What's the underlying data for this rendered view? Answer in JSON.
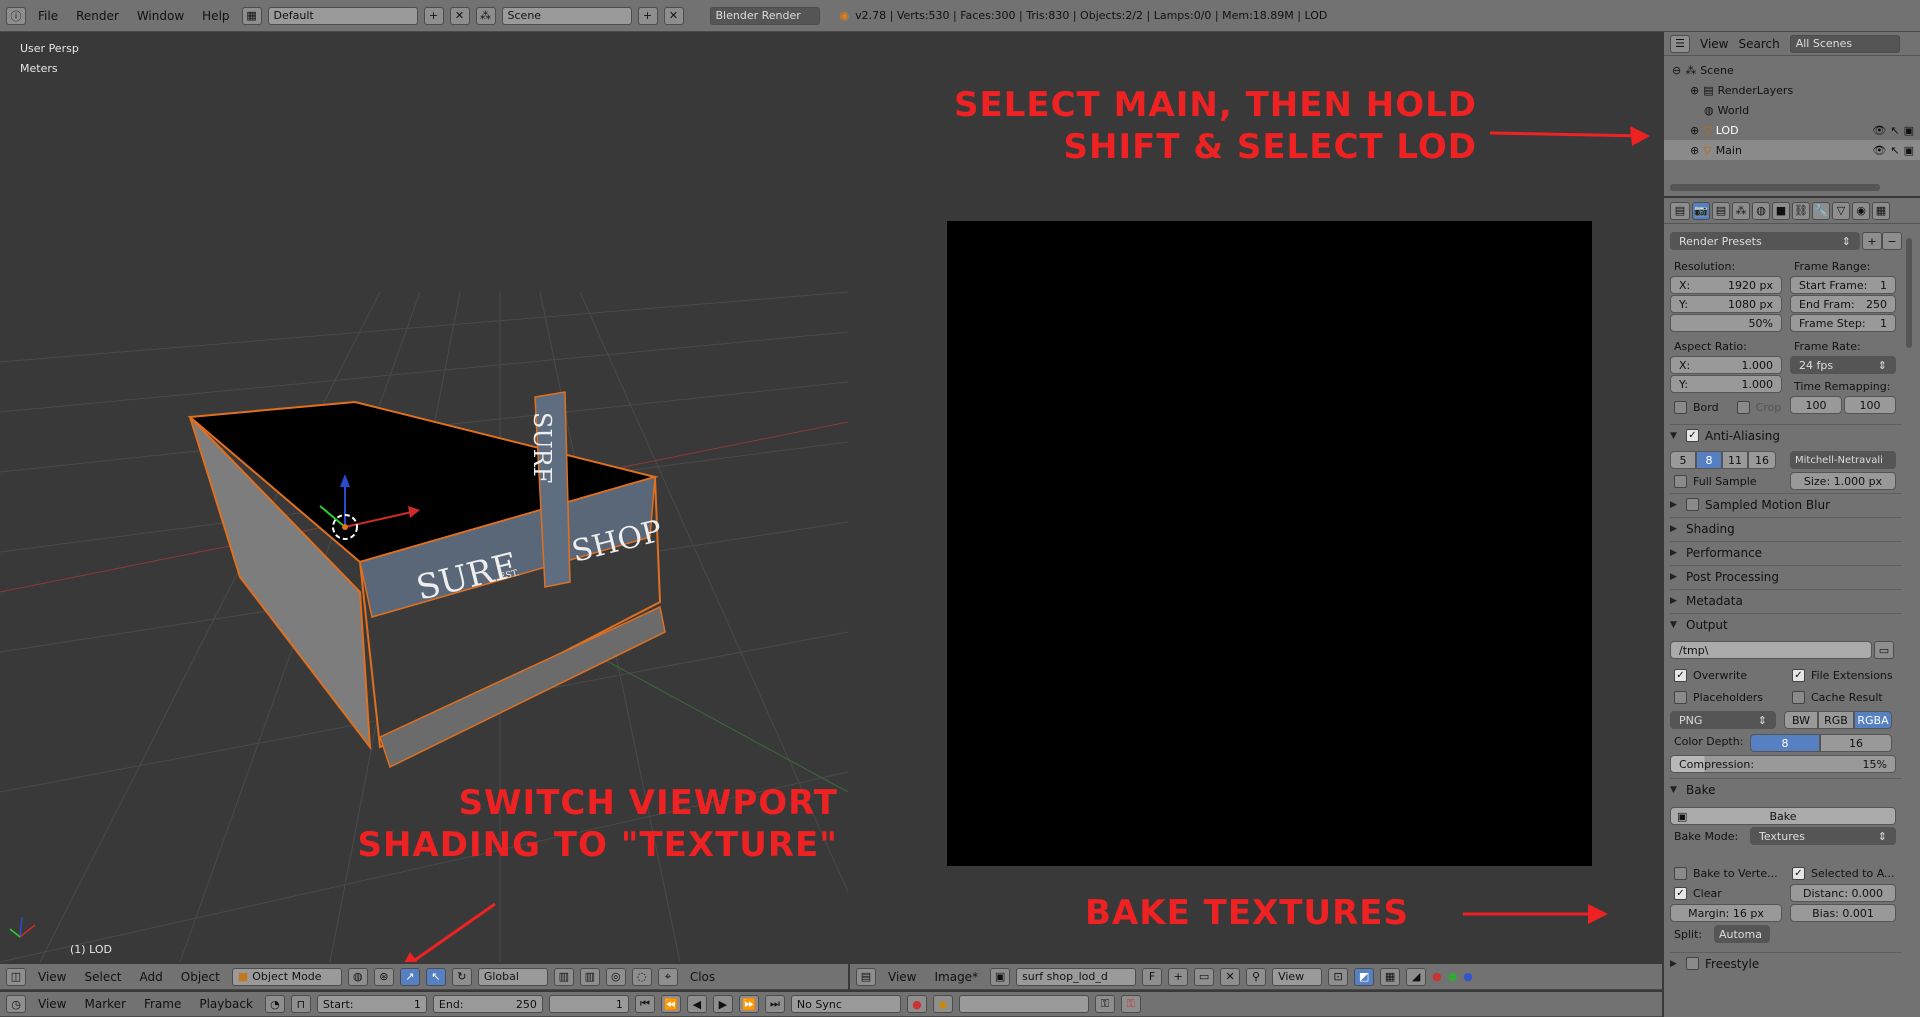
{
  "topbar": {
    "menus": [
      "File",
      "Render",
      "Window",
      "Help"
    ],
    "layout": "Default",
    "scene": "Scene",
    "engine": "Blender Render",
    "stats": "v2.78 | Verts:530 | Faces:300 | Tris:830 | Objects:2/2 | Lamps:0/0 | Mem:18.89M | LOD"
  },
  "viewport": {
    "view_name": "User Persp",
    "units": "Meters",
    "object_label": "(1) LOD",
    "sign_left": "SURF",
    "sign_est": "EST.",
    "sign_right": "SHOP",
    "sign_vertical": "SURF",
    "footer": {
      "menus": [
        "View",
        "Select",
        "Add",
        "Object"
      ],
      "mode": "Object Mode",
      "orientation": "Global",
      "tail": "Clos"
    }
  },
  "annotations": {
    "top": [
      "SELECT MAIN, THEN HOLD",
      "SHIFT & SELECT LOD"
    ],
    "shading": [
      "SWITCH VIEWPORT",
      "SHADING TO \"TEXTURE\""
    ],
    "bake": "BAKE TEXTURES"
  },
  "image_editor": {
    "footer": {
      "menus": [
        "View",
        "Image*"
      ],
      "image_name": "surf shop_lod_d",
      "fake_user": "F",
      "view_label": "View"
    }
  },
  "timeline": {
    "menus": [
      "View",
      "Marker",
      "Frame",
      "Playback"
    ],
    "start_label": "Start:",
    "start": "1",
    "end_label": "End:",
    "end": "250",
    "current": "1",
    "sync": "No Sync"
  },
  "outliner": {
    "view": "View",
    "search": "Search",
    "scenes": "All Scenes",
    "items": [
      {
        "label": "Scene"
      },
      {
        "label": "RenderLayers"
      },
      {
        "label": "World"
      },
      {
        "label": "LOD"
      },
      {
        "label": "Main"
      }
    ]
  },
  "properties": {
    "render_presets": "Render Presets",
    "resolution_label": "Resolution:",
    "res_x_label": "X:",
    "res_x": "1920 px",
    "res_y_label": "Y:",
    "res_y": "1080 px",
    "res_pct": "50%",
    "frame_range_label": "Frame Range:",
    "start_frame_label": "Start Frame:",
    "start_frame": "1",
    "end_frame_label": "End Fram:",
    "end_frame": "250",
    "frame_step_label": "Frame Step:",
    "frame_step": "1",
    "aspect_label": "Aspect Ratio:",
    "asp_x": "1.000",
    "asp_y": "1.000",
    "frame_rate_label": "Frame Rate:",
    "frame_rate": "24 fps",
    "time_remap_label": "Time Remapping:",
    "remap_old": "100",
    "remap_new": "100",
    "bord": "Bord",
    "crop": "Crop",
    "aa_label": "Anti-Aliasing",
    "aa_samples": [
      "5",
      "8",
      "11",
      "16"
    ],
    "aa_filter": "Mitchell-Netravali",
    "full_sample": "Full Sample",
    "aa_size": "Size: 1.000 px",
    "panels": [
      "Sampled Motion Blur",
      "Shading",
      "Performance",
      "Post Processing",
      "Metadata"
    ],
    "output_label": "Output",
    "output_path": "/tmp\\",
    "overwrite": "Overwrite",
    "file_ext": "File Extensions",
    "placeholders": "Placeholders",
    "cache_result": "Cache Result",
    "format": "PNG",
    "color_modes": [
      "BW",
      "RGB",
      "RGBA"
    ],
    "color_depth_label": "Color Depth:",
    "depths": [
      "8",
      "16"
    ],
    "compression_label": "Compression:",
    "compression": "15%",
    "bake_label": "Bake",
    "bake_button": "Bake",
    "bake_mode_label": "Bake Mode:",
    "bake_mode": "Textures",
    "bake_to_vertex": "Bake to Verte...",
    "selected_to_active": "Selected to A...",
    "clear": "Clear",
    "distance": "Distanc: 0.000",
    "margin": "Margin: 16 px",
    "bias": "Bias: 0.001",
    "split_label": "Split:",
    "split": "Automa",
    "freestyle": "Freestyle"
  }
}
